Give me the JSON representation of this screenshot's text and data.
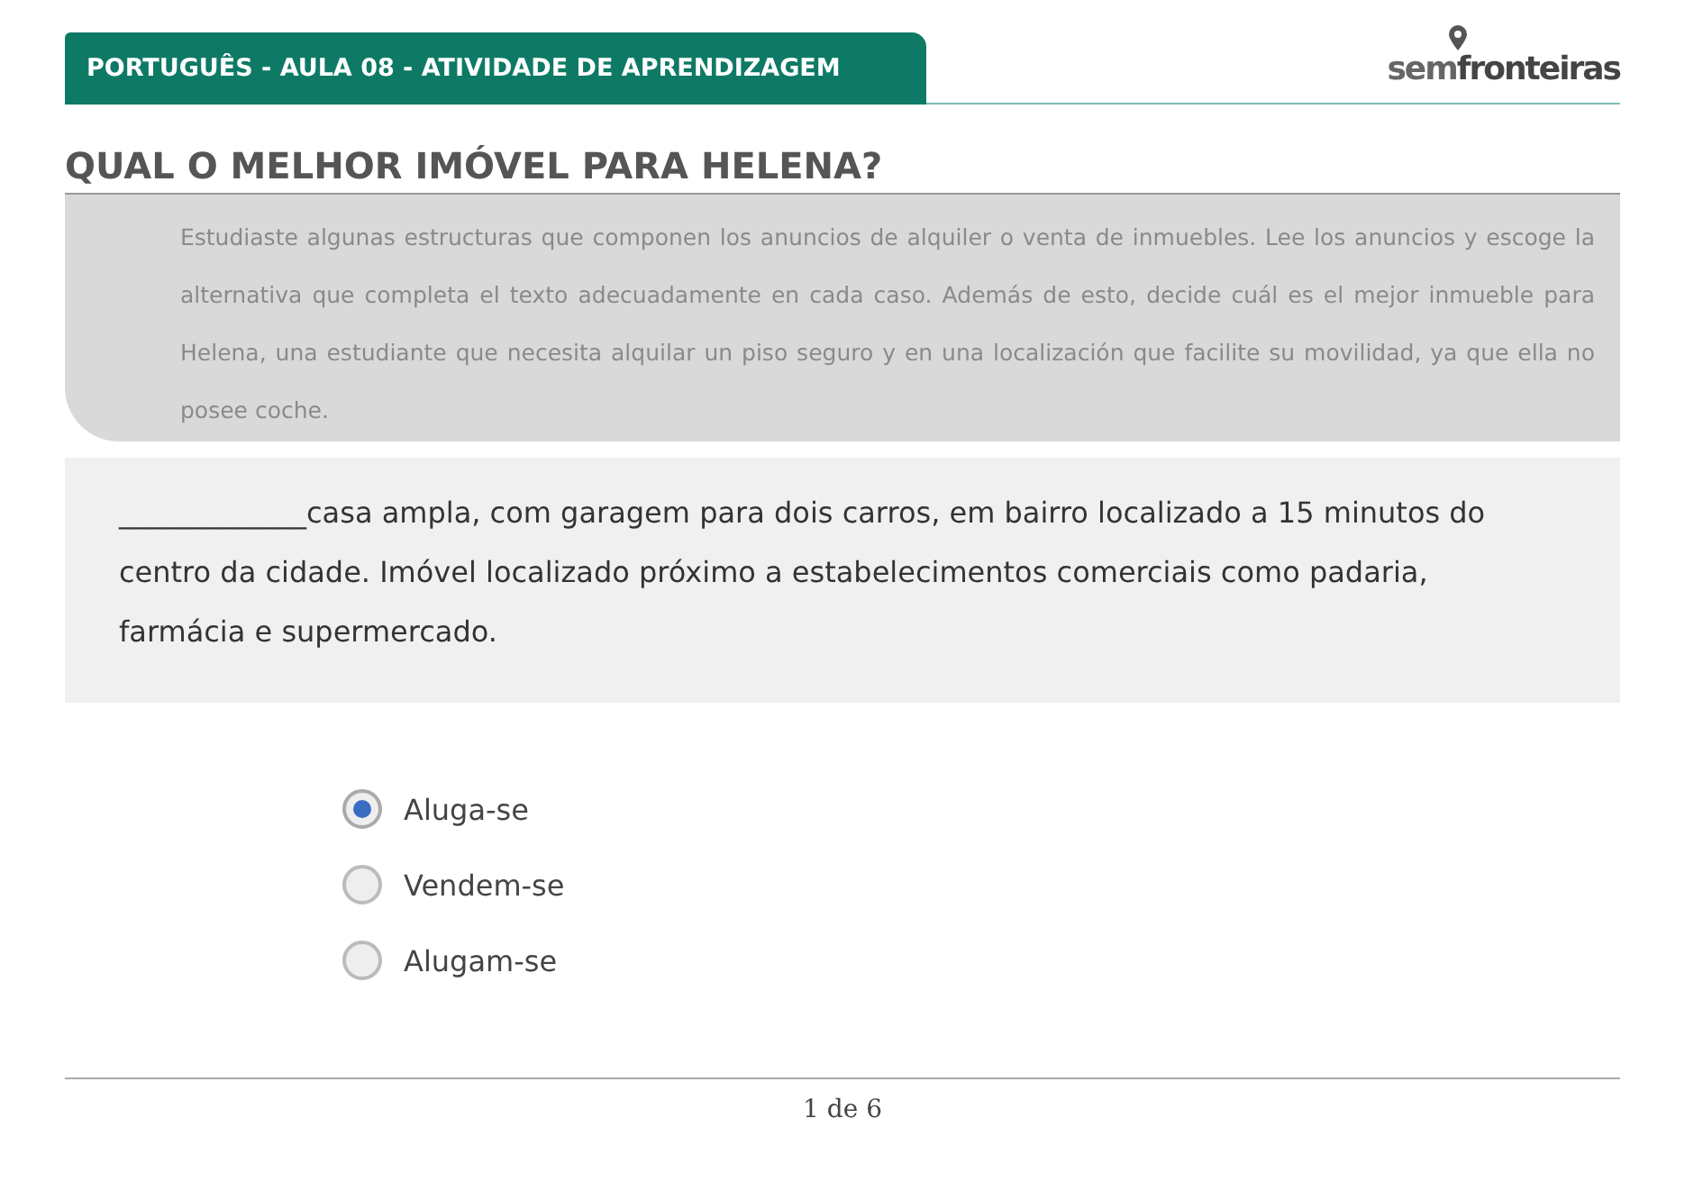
{
  "header": {
    "title": "PORTUGUÊS - AULA 08 - ATIVIDADE DE APRENDIZAGEM",
    "logo": {
      "part_1": "sem",
      "part_2": "fronteiras"
    }
  },
  "question": {
    "title": "QUAL O MELHOR IMÓVEL PARA HELENA?"
  },
  "instructions": "Estudiaste algunas estructuras que componen los anuncios de alquiler o venta de inmuebles. Lee los anuncios y escoge la alternativa que completa el texto adecuadamente en cada caso. Además de esto, decide cuál es el mejor inmueble para Helena, una estudiante que necesita alquilar un piso seguro y en una localización que facilite su movilidad, ya que ella no posee coche.",
  "ad_text": "_____________casa ampla, com garagem para dois carros, em bairro localizado a 15 minutos do centro da cidade. Imóvel localizado próximo a estabelecimentos comerciais como padaria, farmácia e supermercado.",
  "options": [
    {
      "label": "Aluga-se",
      "selected": true
    },
    {
      "label": "Vendem-se",
      "selected": false
    },
    {
      "label": "Alugam-se",
      "selected": false
    }
  ],
  "pager": "1 de 6"
}
